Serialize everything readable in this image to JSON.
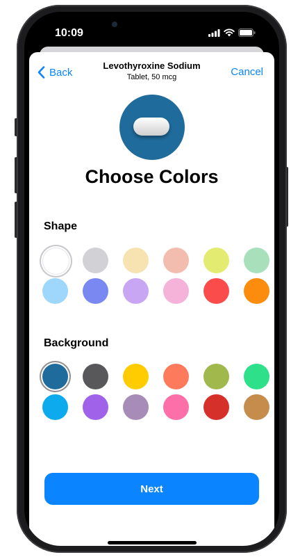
{
  "status_bar": {
    "time": "10:09"
  },
  "nav": {
    "back_label": "Back",
    "title": "Levothyroxine Sodium",
    "subtitle": "Tablet, 50 mcg",
    "cancel_label": "Cancel"
  },
  "preview": {
    "background_color": "#1f6b9b",
    "pill_color": "#ffffff"
  },
  "page_title": "Choose Colors",
  "shape": {
    "label": "Shape",
    "selected": "white",
    "swatches": [
      {
        "name": "white",
        "color": "#ffffff"
      },
      {
        "name": "light-gray",
        "color": "#d1d1d6"
      },
      {
        "name": "cream",
        "color": "#f7e3b2"
      },
      {
        "name": "peach",
        "color": "#f2bcae"
      },
      {
        "name": "lime",
        "color": "#e3ec70"
      },
      {
        "name": "mint",
        "color": "#a8e0bb"
      },
      {
        "name": "light-blue",
        "color": "#9fd6fb"
      },
      {
        "name": "periwinkle",
        "color": "#7a88f2"
      },
      {
        "name": "lavender",
        "color": "#c9a6f4"
      },
      {
        "name": "pink",
        "color": "#f5b3d9"
      },
      {
        "name": "red",
        "color": "#fb4c4c"
      },
      {
        "name": "orange",
        "color": "#fc8c0d"
      }
    ]
  },
  "background": {
    "label": "Background",
    "selected": "dark-blue",
    "swatches": [
      {
        "name": "dark-blue",
        "color": "#1f6b9b"
      },
      {
        "name": "dark-gray",
        "color": "#58585a"
      },
      {
        "name": "yellow",
        "color": "#ffcc02"
      },
      {
        "name": "coral",
        "color": "#fd7b5c"
      },
      {
        "name": "olive",
        "color": "#a1b84c"
      },
      {
        "name": "green",
        "color": "#2ee08a"
      },
      {
        "name": "sky-blue",
        "color": "#0eaaee"
      },
      {
        "name": "purple",
        "color": "#9f62e8"
      },
      {
        "name": "mauve",
        "color": "#a88cb8"
      },
      {
        "name": "hot-pink",
        "color": "#fd6fa9"
      },
      {
        "name": "crimson",
        "color": "#d6302b"
      },
      {
        "name": "bronze",
        "color": "#c68c4c"
      }
    ]
  },
  "next_label": "Next"
}
